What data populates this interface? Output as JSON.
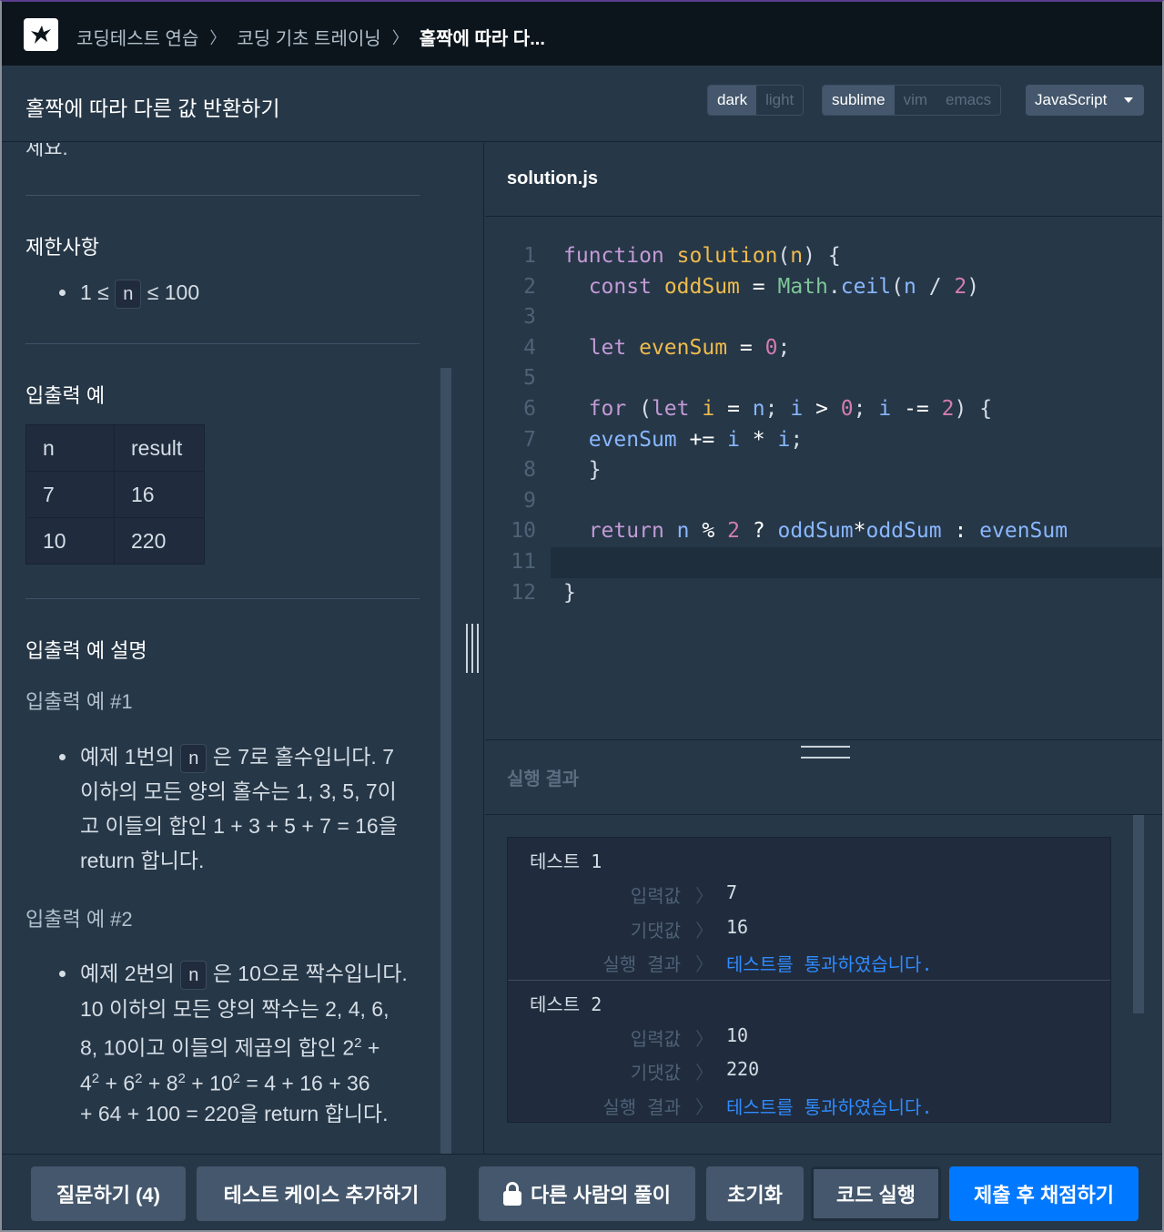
{
  "nav": {
    "breadcrumbs": [
      "코딩테스트 연습",
      "코딩 기초 트레이닝",
      "홀짝에 따라 다..."
    ]
  },
  "header": {
    "title": "홀짝에 따라 다른 값 반환하기",
    "theme_options": [
      "dark",
      "light"
    ],
    "theme_selected": "dark",
    "editor_options": [
      "sublime",
      "vim",
      "emacs"
    ],
    "editor_selected": "sublime",
    "language": "JavaScript"
  },
  "problem": {
    "cut_text": "세요.",
    "constraints_heading": "제한사항",
    "constraint": {
      "pre": "1 ≤",
      "var": "n",
      "post": "≤ 100"
    },
    "io_heading": "입출력 예",
    "io_table": {
      "headers": [
        "n",
        "result"
      ],
      "rows": [
        [
          "7",
          "16"
        ],
        [
          "10",
          "220"
        ]
      ]
    },
    "io_explain_heading": "입출력 예 설명",
    "example1": {
      "title": "입출력 예 #1",
      "lines": [
        {
          "pre": "예제 1번의",
          "var": "n",
          "post": "은 7로 홀수입니다. 7"
        },
        {
          "text": "이하의 모든 양의 홀수는 1, 3, 5, 7이"
        },
        {
          "text": "고 이들의 합인 1 + 3 + 5 + 7 = 16을"
        },
        {
          "text": "return 합니다."
        }
      ]
    },
    "example2": {
      "title": "입출력 예 #2",
      "line1": {
        "pre": "예제 2번의",
        "var": "n",
        "post": "은 10으로 짝수입니다."
      },
      "line2": "10 이하의 모든 양의 짝수는 2, 4, 6,",
      "line3": "8, 10이고 이들의 제곱의 합인 2",
      "line4": "4",
      "line5": "+ 64 + 100 = 220을 return 합니다.",
      "sup": "2",
      "plus": "+",
      "t6": "+ 6",
      "t8": "+ 8",
      "t10": "+ 10",
      "tail4": "= 4 + 16 + 36"
    }
  },
  "editor": {
    "filename": "solution.js",
    "line_numbers": [
      "1",
      "2",
      "3",
      "4",
      "5",
      "6",
      "7",
      "8",
      "9",
      "10",
      "11",
      "12"
    ]
  },
  "result": {
    "title": "실행 결과",
    "labels": {
      "input": "입력값",
      "expected": "기댓값",
      "outcome": "실행 결과",
      "chevron": "〉"
    },
    "tests": [
      {
        "title": "테스트 1",
        "input": "7",
        "expected": "16",
        "outcome": "테스트를 통과하였습니다."
      },
      {
        "title": "테스트 2",
        "input": "10",
        "expected": "220",
        "outcome": "테스트를 통과하였습니다."
      }
    ]
  },
  "footer": {
    "question": "질문하기 (4)",
    "add_test": "테스트 케이스 추가하기",
    "others": "다른 사람의 풀이",
    "reset": "초기화",
    "run": "코드 실행",
    "submit": "제출 후 채점하기"
  }
}
